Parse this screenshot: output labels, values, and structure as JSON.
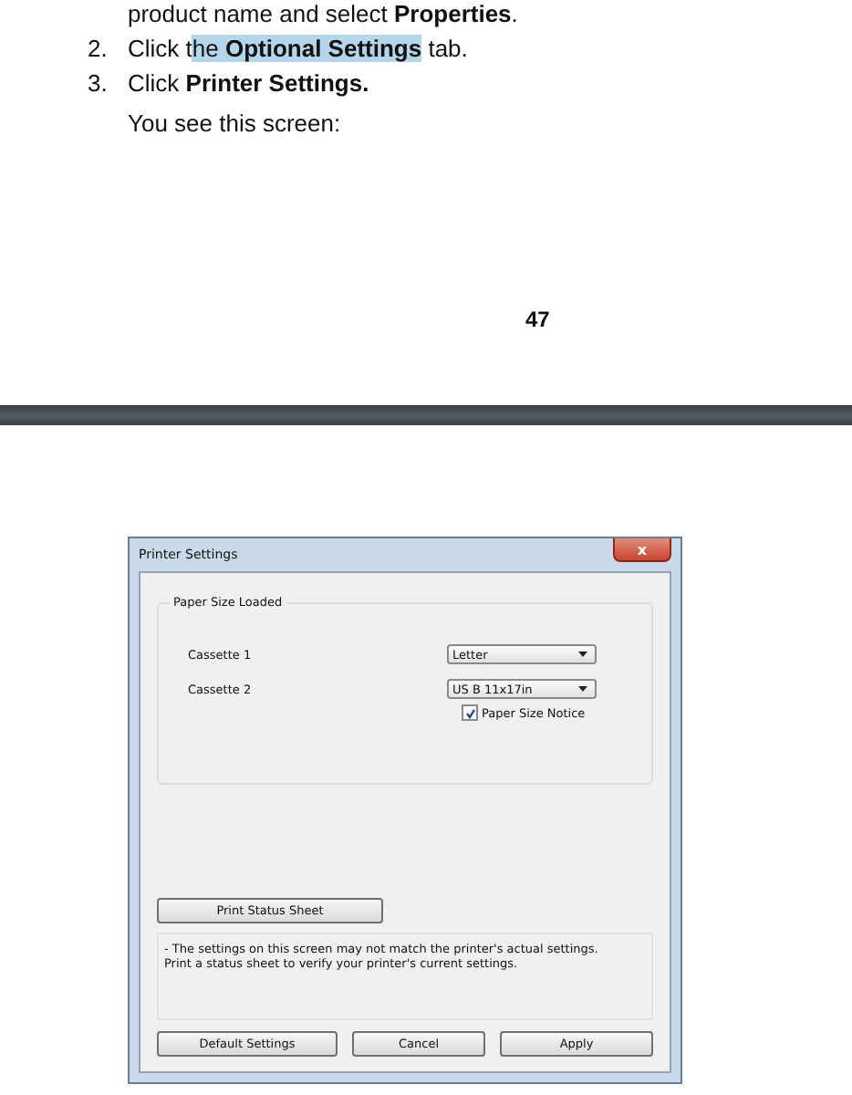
{
  "document": {
    "steps": [
      {
        "segments": [
          {
            "text": "product name and select **Properties**.",
            "selected": false
          }
        ]
      },
      {
        "number": "2.",
        "segments": [
          {
            "text": "Click t",
            "selected": false
          },
          {
            "text": "he **Optional Settings**",
            "selected": true
          },
          {
            "text": " tab.",
            "selected": false
          }
        ]
      },
      {
        "number": "3.",
        "segments": [
          {
            "text": "Click **Printer Settings.**",
            "selected": false
          }
        ]
      }
    ],
    "note": "You see this screen:",
    "page_number": "47"
  },
  "dialog": {
    "title": "Printer Settings",
    "close": "x",
    "group": {
      "title": "Paper Size Loaded",
      "rows": [
        {
          "label": "Cassette 1",
          "value": "Letter"
        },
        {
          "label": "Cassette 2",
          "value": "US B 11x17in"
        }
      ],
      "checkbox": {
        "label": "Paper Size Notice",
        "checked": true
      }
    },
    "status_button": "Print Status Sheet",
    "message": [
      "- The settings on this screen may not match the printer's actual settings.",
      "Print a status sheet to verify your printer's current settings."
    ],
    "buttons": [
      "Default Settings",
      "Cancel",
      "Apply"
    ]
  }
}
